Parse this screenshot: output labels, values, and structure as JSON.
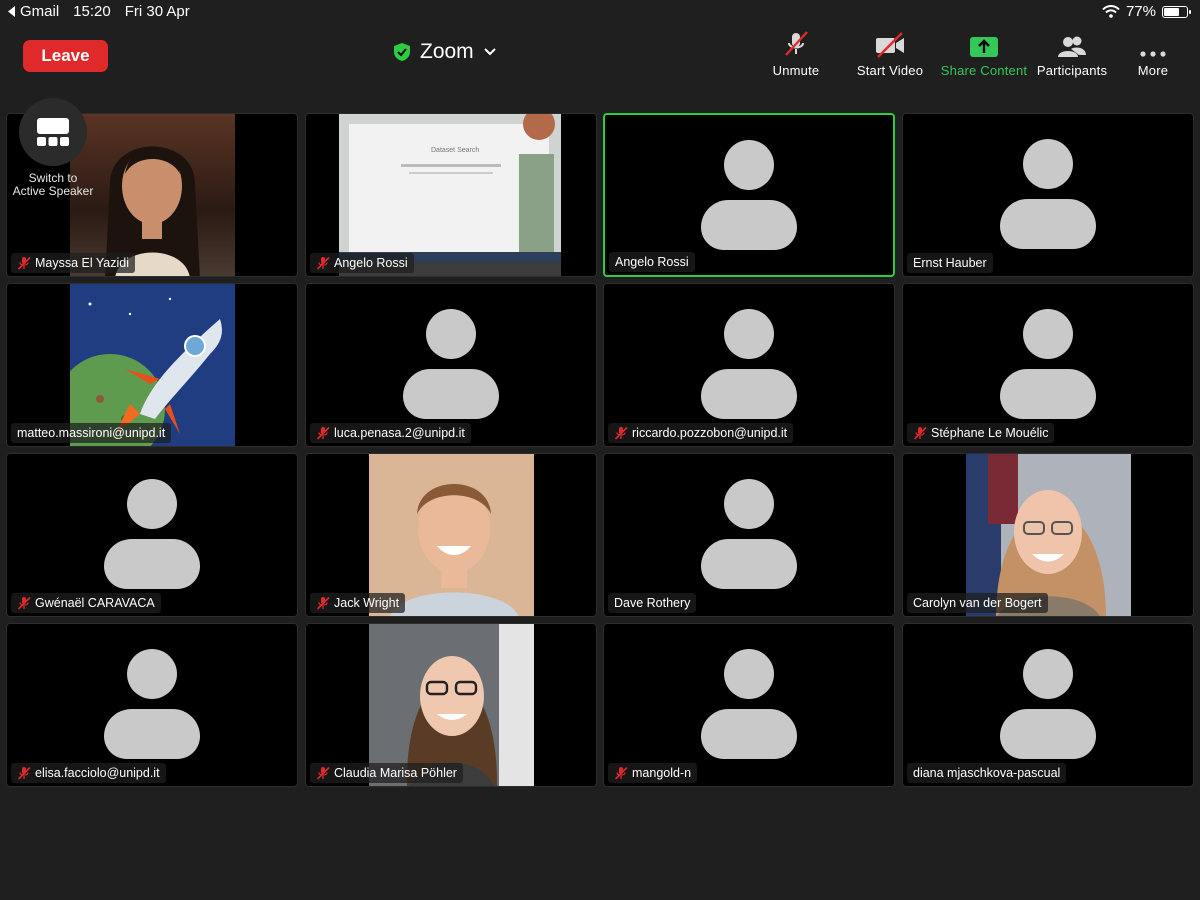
{
  "status_bar": {
    "back_app": "Gmail",
    "time": "15:20",
    "date": "Fri 30 Apr",
    "battery": "77%",
    "battery_level": 0.77,
    "icons": [
      "back-arrow-icon",
      "wifi-icon",
      "battery-icon"
    ]
  },
  "toolbar": {
    "leave_label": "Leave",
    "title": "Zoom",
    "buttons": [
      {
        "label": "Unmute",
        "icon": "muted-microphone-icon"
      },
      {
        "label": "Start Video",
        "icon": "video-off-icon"
      },
      {
        "label": "Share Content",
        "icon": "share-screen-icon"
      },
      {
        "label": "Participants",
        "icon": "participants-icon"
      },
      {
        "label": "More",
        "icon": "more-dots-icon"
      }
    ]
  },
  "switch_view": {
    "label_line1": "Switch to",
    "label_line2": "Active Speaker",
    "icon": "gallery-view-icon"
  },
  "colors": {
    "leave": "#e0292b",
    "share": "#34c759",
    "active_border": "#2ecc40",
    "mute": "#e0292b"
  },
  "participants": [
    {
      "name": "Mayssa El Yazidi",
      "muted": true,
      "video": "photo-woman"
    },
    {
      "name": "Angelo Rossi",
      "muted": true,
      "video": "screen-dataset-search"
    },
    {
      "name": "Angelo Rossi",
      "muted": false,
      "video": null,
      "active_speaker": true
    },
    {
      "name": "Ernst Hauber",
      "muted": false,
      "video": null
    },
    {
      "name": "matteo.massironi@unipd.it",
      "muted": false,
      "video": "rocket-painting"
    },
    {
      "name": "luca.penasa.2@unipd.it",
      "muted": true,
      "video": null
    },
    {
      "name": "riccardo.pozzobon@unipd.it",
      "muted": true,
      "video": null
    },
    {
      "name": "Stéphane Le Mouélic",
      "muted": true,
      "video": null
    },
    {
      "name": "Gwénaël CARAVACA",
      "muted": true,
      "video": null
    },
    {
      "name": "Jack Wright",
      "muted": true,
      "video": "photo-man"
    },
    {
      "name": "Dave Rothery",
      "muted": false,
      "video": null
    },
    {
      "name": "Carolyn van der Bogert",
      "muted": false,
      "video": "photo-woman-glasses"
    },
    {
      "name": "elisa.facciolo@unipd.it",
      "muted": true,
      "video": null
    },
    {
      "name": "Claudia Marisa Pöhler",
      "muted": true,
      "video": "photo-woman-glasses-2"
    },
    {
      "name": "mangold-n",
      "muted": true,
      "video": null
    },
    {
      "name": "diana mjaschkova-pascual",
      "muted": false,
      "video": null
    }
  ],
  "screen_text": "Dataset Search"
}
